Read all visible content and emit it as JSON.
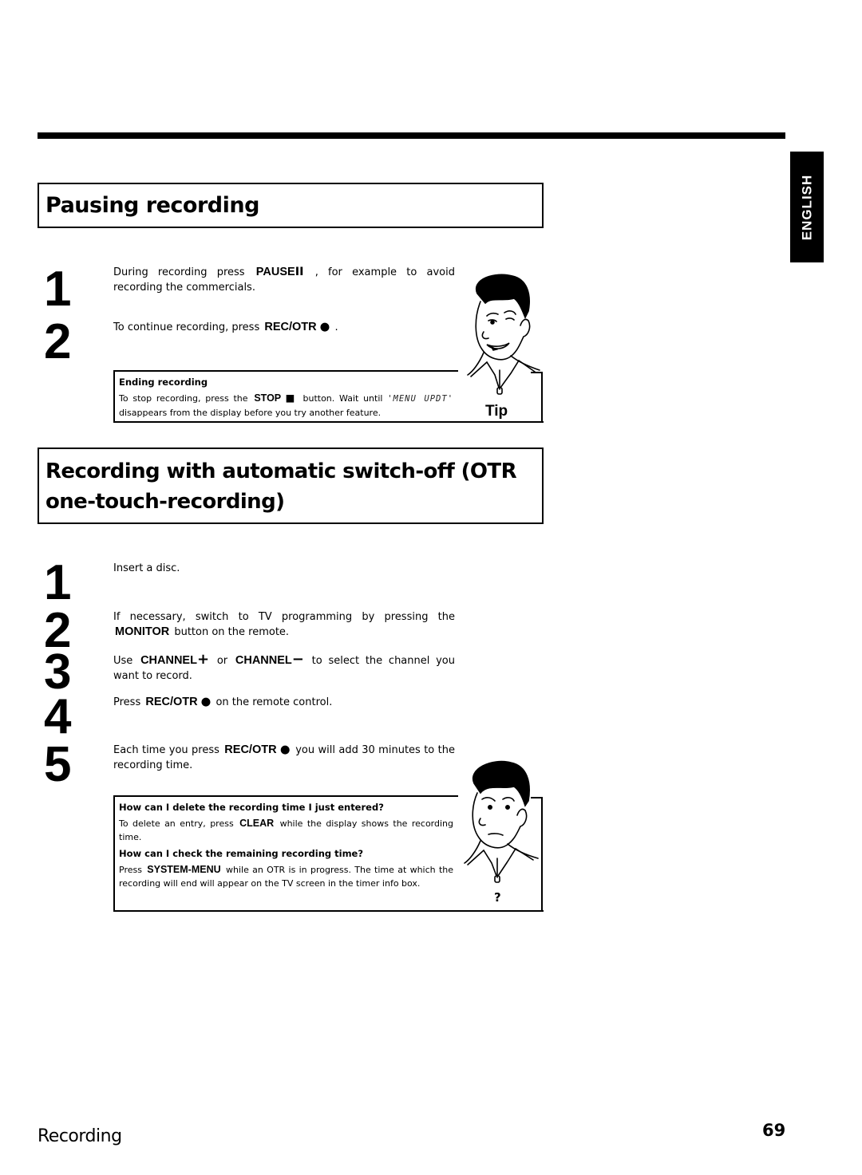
{
  "language_tab": "ENGLISH",
  "sections": [
    {
      "title": "Pausing recording",
      "steps": [
        {
          "number": "1",
          "pre": "During recording press",
          "key": "PAUSE",
          "symbol": "II",
          "post": ", for example to avoid recording the commercials."
        },
        {
          "number": "2",
          "pre": "To continue recording, press",
          "key": "REC/OTR",
          "symbol": "●",
          "post": "."
        }
      ],
      "tip": {
        "label": "Tip",
        "title": "Ending recording",
        "body_pre": "To stop recording, press the",
        "key": "STOP",
        "symbol": "■",
        "body_mid": "button. Wait until",
        "display_text": "'MENU UPDT'",
        "body_post": "disappears from the display before you try another feature."
      }
    },
    {
      "title": "Recording with automatic switch-off (OTR one-touch-recording)",
      "steps": [
        {
          "number": "1",
          "text": "Insert a disc."
        },
        {
          "number": "2",
          "pre": "If necessary, switch to TV programming by pressing the",
          "key": "MONITOR",
          "post": "button on the remote."
        },
        {
          "number": "3",
          "pre": "Use",
          "key1": "CHANNEL",
          "symbol1": "+",
          "mid": "or",
          "key2": "CHANNEL",
          "symbol2": "−",
          "post": "to select the channel you want to record."
        },
        {
          "number": "4",
          "pre": "Press",
          "key": "REC/OTR",
          "symbol": "●",
          "post": "on the remote control."
        },
        {
          "number": "5",
          "pre": "Each time you press",
          "key": "REC/OTR",
          "symbol": "●",
          "post": "you will add 30 minutes to the recording time."
        }
      ],
      "faq": {
        "label": "?",
        "items": [
          {
            "question": "How can I delete the recording time I just entered?",
            "pre": "To delete an entry, press",
            "key": "CLEAR",
            "post": "while the display shows the recording time."
          },
          {
            "question": "How can I check the remaining recording time?",
            "pre": "Press",
            "key": "SYSTEM-MENU",
            "post": "while an OTR is in progress. The time at which the recording will end will appear on the TV screen in the timer info box."
          }
        ]
      }
    }
  ],
  "footer": {
    "section_title": "Recording",
    "page_number": "69"
  }
}
